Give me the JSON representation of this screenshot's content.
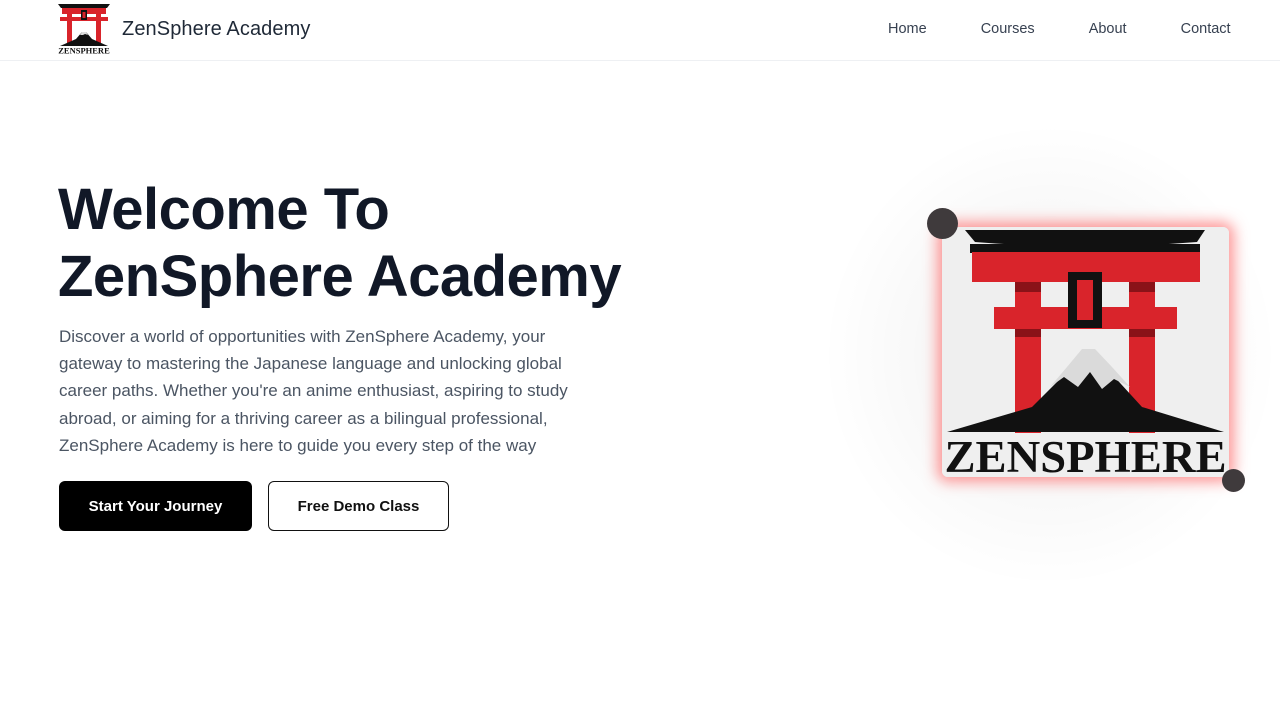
{
  "header": {
    "brand_name": "ZenSphere Academy",
    "logo_text": "ZENSPHERE",
    "nav": [
      {
        "label": "Home"
      },
      {
        "label": "Courses"
      },
      {
        "label": "About"
      },
      {
        "label": "Contact"
      }
    ]
  },
  "hero": {
    "title_line1": "Welcome To",
    "title_line2": "ZenSphere Academy",
    "description": "Discover a world of opportunities with ZenSphere Academy, your gateway to mastering the Japanese language and unlocking global career paths. Whether you're an anime enthusiast, aspiring to study abroad, or aiming for a thriving career as a bilingual professional, ZenSphere Academy is here to guide you every step of the way",
    "primary_button": "Start Your Journey",
    "secondary_button": "Free Demo Class"
  },
  "logo_card": {
    "logo_text": "ZENSPHERE"
  },
  "colors": {
    "torii_red": "#d9242b",
    "primary_button_bg": "#000000",
    "glow_red": "#ff4646",
    "text_dark": "#111827",
    "text_muted": "#4b5563"
  }
}
